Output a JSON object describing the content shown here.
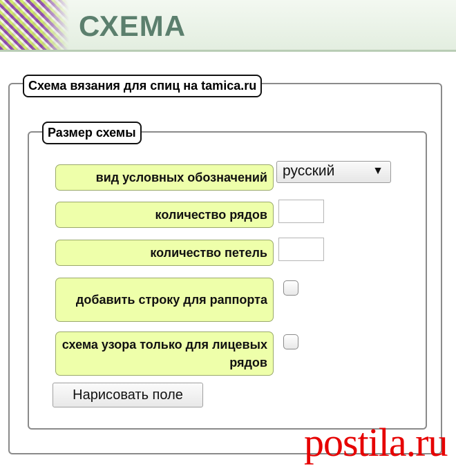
{
  "header": {
    "logo_icon": "knitting-pattern-logo-icon",
    "site_title": "СХЕМА"
  },
  "form": {
    "outer_legend": "Схема вязания для спиц на tamica.ru",
    "inner_legend": "Размер схемы",
    "rows": [
      {
        "label": "вид условных обозначений",
        "control": "select",
        "value": "русский",
        "arrow": "▼"
      },
      {
        "label": "количество рядов",
        "control": "text",
        "value": ""
      },
      {
        "label": "количество петель",
        "control": "text",
        "value": ""
      },
      {
        "label": "добавить строку для раппорта",
        "control": "checkbox",
        "checked": false
      },
      {
        "label": "схема узора только для лицевых рядов",
        "control": "checkbox",
        "checked": false
      }
    ],
    "draw_button": "Нарисовать поле"
  },
  "watermark": "postila.ru",
  "colors": {
    "label_bg": "#eeffaa",
    "title": "#5b7f6d",
    "watermark": "#e60000"
  }
}
